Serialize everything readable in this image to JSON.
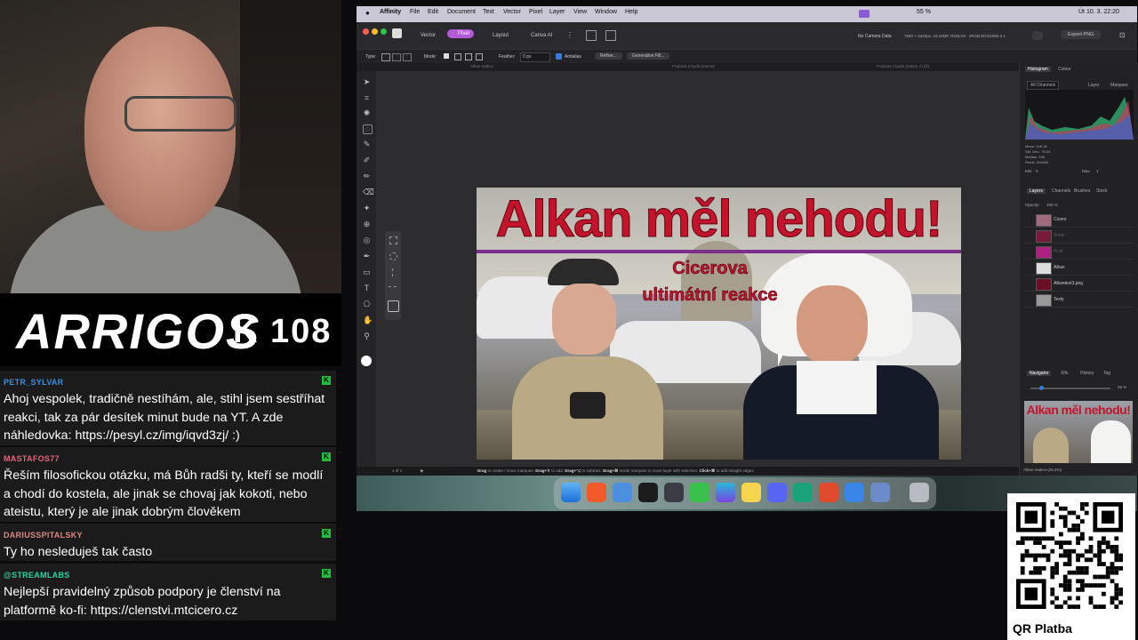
{
  "stream": {
    "brand": "ARRIGOS",
    "counter": "K 108"
  },
  "chat": {
    "messages": [
      {
        "user": "PETR_SYLVAR",
        "color": "#3a8ee6",
        "text": "Ahoj vespolek, tradičně nestíhám, ale, stihl jsem sestříhat reakci, tak za pár desítek minut bude na YT. A zde náhledovka: https://pesyl.cz/img/iqvd3zj/ :)"
      },
      {
        "user": "MASTAFOS77",
        "color": "#e0677a",
        "text": "Řeším filosofickou otázku, má Bůh radši ty, kteří se modlí a chodí do kostela, ale jinak se chovaj jak kokoti, nebo ateistu, který je ale jinak dobrým člověkem"
      },
      {
        "user": "DARIUSSPITALSKY",
        "color": "#d98a85",
        "text": "Ty ho nesleduješ tak často"
      },
      {
        "user": "@STREAMLABS",
        "color": "#31d1a0",
        "text": "Nejlepší pravidelný způsob podpory je členství na platformě ko-fi: https://clenstvi.mtcicero.cz"
      }
    ],
    "badge": "K"
  },
  "app": {
    "menu": [
      "Affinity",
      "File",
      "Edit",
      "Document",
      "Text",
      "Vector",
      "Pixel",
      "Layer",
      "View",
      "Window",
      "Help"
    ],
    "clock": "Út 10. 3.  22:20",
    "battery": "55 %",
    "personas": [
      "Vector",
      "Pixel",
      "Layout",
      "Canva AI"
    ],
    "active_persona": "Pixel",
    "doc_info": "No Camera Data",
    "doc_meta": "7680 × 4320px, 23.16MP, RGBA/8 · sRGB IEC61966-2.1",
    "export_button": "Export PNG",
    "context": {
      "type_label": "Type:",
      "mode_label": "Mode:",
      "feather_label": "Feather:",
      "feather_value": "0 px",
      "antialias_label": "Antialias",
      "refine_button": "Refine...",
      "generative_button": "Generative Fill..."
    },
    "doc_tabs": [
      "Alkan reakce",
      "Podcast 2 buds (meme)",
      "Podcast 3 buds (nature 2) (iii)"
    ],
    "status": {
      "pages": "1 of 1",
      "hint_parts": [
        {
          "kw": "Drag",
          "rest": " to create / move marquee. "
        },
        {
          "kw": "Drag+⇧",
          "rest": " to add. "
        },
        {
          "kw": "Drag+⌥",
          "rest": " to subtract. "
        },
        {
          "kw": "Drag+⌘",
          "rest": " inside marquee to move layer with selection. "
        },
        {
          "kw": "Click+⌘",
          "rest": " to add straight edges"
        }
      ]
    },
    "thumbnail": {
      "title": "Alkan měl nehodu!",
      "subtitle_line1": "Cicerova",
      "subtitle_line2": "ultimátní reakce"
    },
    "histogram": {
      "tabs": [
        "Histogram",
        "Colour"
      ],
      "channel": "All Channels",
      "options": [
        "Layer",
        "Marquee"
      ],
      "stats": [
        "Mean: 108.18",
        "Std. Dev.: 75.34",
        "Median: 106",
        "Pixels: 518400"
      ],
      "min_label": "Min:",
      "min_value": "0",
      "max_label": "Max:",
      "max_value": "1"
    },
    "layers": {
      "tabs": [
        "Layers",
        "Channels",
        "Brushes",
        "Stock"
      ],
      "opacity_label": "Opacity:",
      "opacity_value": "100 %",
      "items": [
        "Cicero",
        "Vrstvi",
        "Pruh",
        "Alkan",
        "Alkantext3.png",
        "Texty"
      ]
    },
    "navigator": {
      "tabs": [
        "Navigator",
        "Xlfs",
        "History",
        "Tag"
      ],
      "zoom": "29 %",
      "caption": "Alkan reakce (29.2%)"
    }
  },
  "qr": {
    "label": "QR Platba"
  }
}
